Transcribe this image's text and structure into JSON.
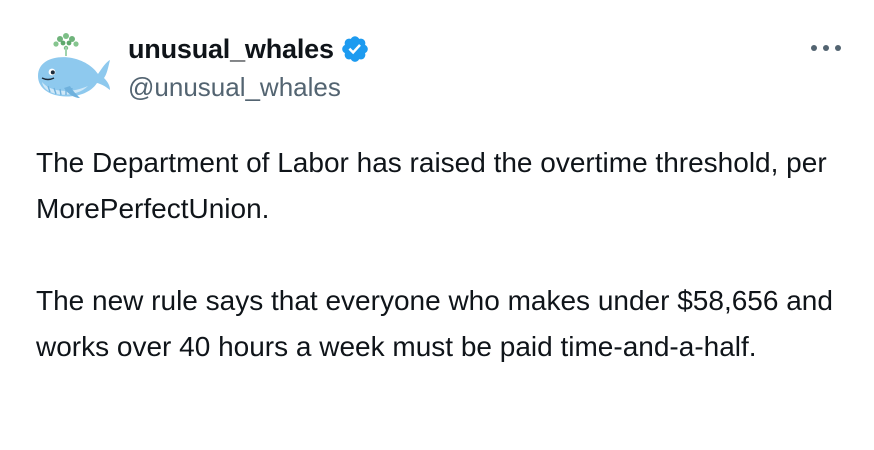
{
  "author": {
    "display_name": "unusual_whales",
    "handle": "@unusual_whales",
    "verified": true,
    "avatar_icon": "whale-logo-icon",
    "verified_icon": "verified-badge-icon"
  },
  "menu": {
    "more_icon": "more-options-icon"
  },
  "tweet": {
    "paragraphs": [
      "The Department of Labor has raised the overtime threshold, per MorePerfectUnion.",
      "The new rule says that everyone who makes under $58,656 and works over 40 hours a week must be paid time-and-a-half."
    ]
  },
  "colors": {
    "text": "#0f1419",
    "secondary_text": "#536471",
    "verified_blue": "#1d9bf0",
    "whale_blue": "#8ec9ee",
    "whale_spout_green": "#6fb37b"
  }
}
